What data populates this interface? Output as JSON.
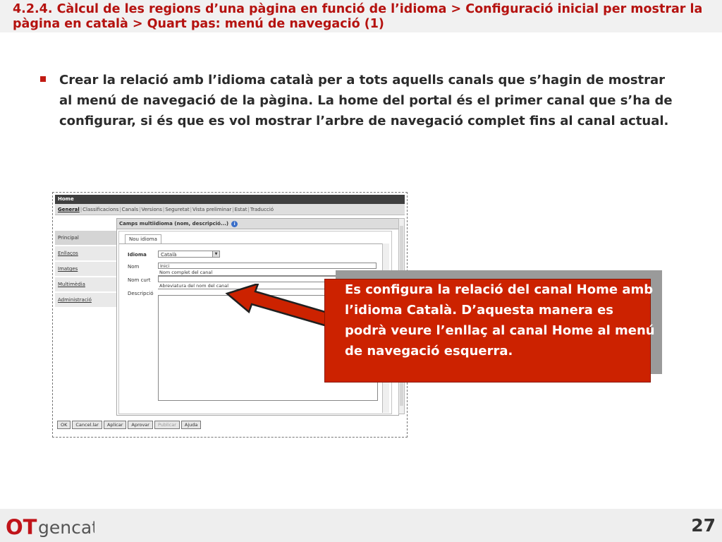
{
  "slide": {
    "title": "4.2.4. Càlcul de les regions d’una pàgina en funció de l’idioma > Configuració inicial per mostrar la pàgina en català > Quart pas: menú de navegació (1)",
    "bullet": "Crear la relació amb l’idioma català per a tots aquells canals que s’hagin de mostrar al menú de navegació de la pàgina. La home del portal és el primer canal que s’ha de configurar, si és que es vol mostrar l’arbre de navegació complet fins al canal actual.",
    "callout": "Es configura la relació del canal Home amb l’idioma Català. D’aquesta manera es podrà veure l’enllaç al canal Home al menú de navegació esquerra.",
    "page_number": "27",
    "accent_color": "#c11b13",
    "callout_color": "#cc2200"
  },
  "screenshot": {
    "window_title": "Home",
    "tabs": [
      {
        "label": "General"
      },
      {
        "label": "Classificacions"
      },
      {
        "label": "Canals"
      },
      {
        "label": "Versions"
      },
      {
        "label": "Seguretat"
      },
      {
        "label": "Vista preliminar"
      },
      {
        "label": "Estat"
      },
      {
        "label": "Traducció"
      }
    ],
    "menu": [
      {
        "label": "Principal"
      },
      {
        "label": "Enllaços"
      },
      {
        "label": "Imatges"
      },
      {
        "label": "Multimèdia"
      },
      {
        "label": "Administració"
      }
    ],
    "panel_title": "Camps multiidioma (nom, descripció...)",
    "inner_tab": "Nou idioma",
    "form": {
      "idioma_label": "Idioma",
      "idioma_value": "Català",
      "nom_label": "Nom",
      "nom_value": "Inici",
      "nom_placeholder": "Nom complet del canal",
      "nomcurt_label": "Nom curt",
      "nomcurt_placeholder": "Abreviatura del nom del canal",
      "descripcio_label": "Descripció"
    },
    "buttons": [
      {
        "label": "OK"
      },
      {
        "label": "Cancel.lar"
      },
      {
        "label": "Aplicar"
      },
      {
        "label": "Aprovar"
      },
      {
        "label": "Publicar"
      },
      {
        "label": "Ajuda"
      }
    ]
  },
  "logo": {
    "part1": "OT",
    "part2": "gencat"
  }
}
